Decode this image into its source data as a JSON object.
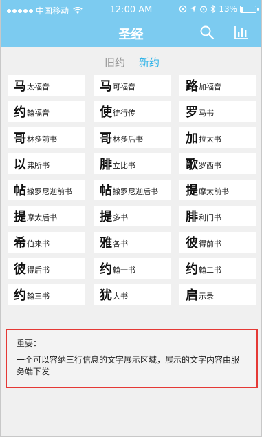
{
  "status": {
    "carrier": "中国移动",
    "time": "12:00 AM",
    "battery": "13%",
    "battery_level": 0.13
  },
  "nav": {
    "title": "圣经"
  },
  "tabs": {
    "old": "旧约",
    "new": "新约",
    "active_color": "#2fb3e8"
  },
  "books": [
    {
      "big": "马",
      "small": "太福音"
    },
    {
      "big": "马",
      "small": "可福音"
    },
    {
      "big": "路",
      "small": "加福音"
    },
    {
      "big": "约",
      "small": "翰福音"
    },
    {
      "big": "使",
      "small": "徒行传"
    },
    {
      "big": "罗",
      "small": "马书"
    },
    {
      "big": "哥",
      "small": "林多前书"
    },
    {
      "big": "哥",
      "small": "林多后书"
    },
    {
      "big": "加",
      "small": "拉太书"
    },
    {
      "big": "以",
      "small": "弗所书"
    },
    {
      "big": "腓",
      "small": "立比书"
    },
    {
      "big": "歌",
      "small": "罗西书"
    },
    {
      "big": "帖",
      "small": "撒罗尼迦前书"
    },
    {
      "big": "帖",
      "small": "撒罗尼迦后书"
    },
    {
      "big": "提",
      "small": "摩太前书"
    },
    {
      "big": "提",
      "small": "摩太后书"
    },
    {
      "big": "提",
      "small": "多书"
    },
    {
      "big": "腓",
      "small": "利门书"
    },
    {
      "big": "希",
      "small": "伯来书"
    },
    {
      "big": "雅",
      "small": "各书"
    },
    {
      "big": "彼",
      "small": "得前书"
    },
    {
      "big": "彼",
      "small": "得后书"
    },
    {
      "big": "约",
      "small": "翰一书"
    },
    {
      "big": "约",
      "small": "翰二书"
    },
    {
      "big": "约",
      "small": "翰三书"
    },
    {
      "big": "犹",
      "small": "大书"
    },
    {
      "big": "启",
      "small": "示录"
    }
  ],
  "notice": {
    "title": "重要：",
    "body": "一个可以容纳三行信息的文字展示区域，展示的文字内容由服务端下发",
    "border_color": "#e53935"
  },
  "colors": {
    "header": "#7ccbf0",
    "background": "#f0f0f0"
  }
}
